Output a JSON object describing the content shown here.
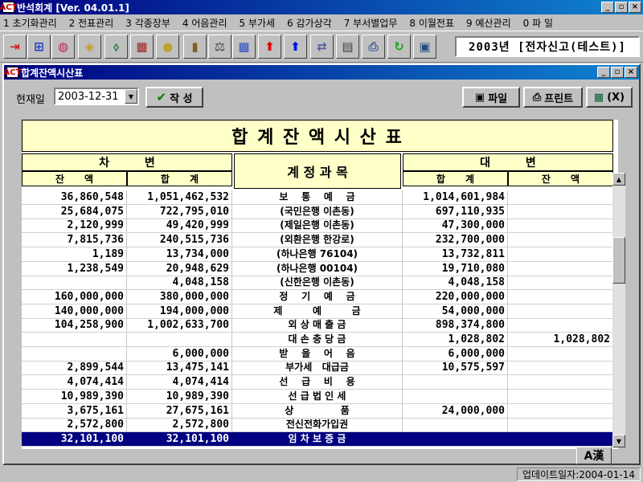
{
  "app": {
    "title": "반석회계 [Ver. 04.01.1]"
  },
  "window_buttons": {
    "minimize": "_",
    "restore": "▫",
    "close": "×"
  },
  "menu": [
    "1 초기화관리",
    "2 전표관리",
    "3 각종장부",
    "4 어음관리",
    "5 부가세",
    "6 감가상각",
    "7 부서별업무",
    "8 이월전표",
    "9 예산관리",
    "0 파 일"
  ],
  "toolbar": {
    "icons": [
      "exit-icon",
      "tree-icon",
      "globe-icon",
      "coupon-icon",
      "tag-icon",
      "abacus-icon",
      "coin-icon",
      "book-icon",
      "scale-icon",
      "grid-icon",
      "arrow-up-red-icon",
      "arrow-up-blue-icon",
      "convert-icon",
      "calculator-icon",
      "printer-icon",
      "refresh-icon",
      "report-icon"
    ],
    "colors": [
      "#d02020",
      "#2040c0",
      "#c02060",
      "#c0a020",
      "#208040",
      "#a02020",
      "#c0a030",
      "#806020",
      "#404040",
      "#3050c0",
      "#e00000",
      "#0010e0",
      "#5060a0",
      "#404040",
      "#4060a0",
      "#20a020",
      "#205080"
    ],
    "glyphs": [
      "⇥",
      "⊞",
      "◍",
      "◈",
      "⬨",
      "▦",
      "●",
      "▮",
      "⚖",
      "▩",
      "⬆",
      "⬆",
      "⇄",
      "▤",
      "⎙",
      "↻",
      "▣"
    ]
  },
  "year_display": "2003년 [전자신고(테스트)]",
  "child_window": {
    "title": "합계잔액시산표"
  },
  "controls": {
    "date_label": "현재일",
    "date_value": "2003-12-31",
    "write_button": "작 성",
    "write_icon": "✔",
    "file_button": "파일",
    "file_icon": "▣",
    "print_button": "프린트",
    "print_icon": "⎙",
    "exit_button": "(X)",
    "exit_icon": "▦"
  },
  "report": {
    "title": "합 계 잔 액 시 산 표",
    "debit_header": "차         변",
    "credit_header": "대         변",
    "account_header": "계 정 과 목",
    "balance_header": "잔      액",
    "total_header": "합      계"
  },
  "rows": [
    {
      "dr_bal": "36,860,548",
      "dr_sum": "1,051,462,532",
      "account": "보    통    예    금",
      "cr_sum": "1,014,601,984",
      "cr_bal": ""
    },
    {
      "dr_bal": "25,684,075",
      "dr_sum": "722,795,010",
      "account": "(국민은행 이촌동)",
      "cr_sum": "697,110,935",
      "cr_bal": ""
    },
    {
      "dr_bal": "2,120,999",
      "dr_sum": "49,420,999",
      "account": "(제일은행 이촌동)",
      "cr_sum": "47,300,000",
      "cr_bal": ""
    },
    {
      "dr_bal": "7,815,736",
      "dr_sum": "240,515,736",
      "account": "(외환은행 한강로)",
      "cr_sum": "232,700,000",
      "cr_bal": ""
    },
    {
      "dr_bal": "1,189",
      "dr_sum": "13,734,000",
      "account": "(하나은행 76104)",
      "cr_sum": "13,732,811",
      "cr_bal": ""
    },
    {
      "dr_bal": "1,238,549",
      "dr_sum": "20,948,629",
      "account": "(하나은행 00104)",
      "cr_sum": "19,710,080",
      "cr_bal": ""
    },
    {
      "dr_bal": "",
      "dr_sum": "4,048,158",
      "account": "(신한은행 이촌동)",
      "cr_sum": "4,048,158",
      "cr_bal": ""
    },
    {
      "dr_bal": "160,000,000",
      "dr_sum": "380,000,000",
      "account": "정    기    예    금",
      "cr_sum": "220,000,000",
      "cr_bal": ""
    },
    {
      "dr_bal": "140,000,000",
      "dr_sum": "194,000,000",
      "account": "제         예         금",
      "cr_sum": "54,000,000",
      "cr_bal": ""
    },
    {
      "dr_bal": "104,258,900",
      "dr_sum": "1,002,633,700",
      "account": "외 상 매 출 금",
      "cr_sum": "898,374,800",
      "cr_bal": ""
    },
    {
      "dr_bal": "",
      "dr_sum": "",
      "account": "대 손 충 당 금",
      "cr_sum": "1,028,802",
      "cr_bal": "1,028,802"
    },
    {
      "dr_bal": "",
      "dr_sum": "6,000,000",
      "account": "받    을    어    음",
      "cr_sum": "6,000,000",
      "cr_bal": ""
    },
    {
      "dr_bal": "2,899,544",
      "dr_sum": "13,475,141",
      "account": "부가세   대급금",
      "cr_sum": "10,575,597",
      "cr_bal": ""
    },
    {
      "dr_bal": "4,074,414",
      "dr_sum": "4,074,414",
      "account": "선    급    비    용",
      "cr_sum": "",
      "cr_bal": ""
    },
    {
      "dr_bal": "10,989,390",
      "dr_sum": "10,989,390",
      "account": "선 급 법 인 세",
      "cr_sum": "",
      "cr_bal": ""
    },
    {
      "dr_bal": "3,675,161",
      "dr_sum": "27,675,161",
      "account": "상              품",
      "cr_sum": "24,000,000",
      "cr_bal": ""
    },
    {
      "dr_bal": "2,572,800",
      "dr_sum": "2,572,800",
      "account": "전신전화가입권",
      "cr_sum": "",
      "cr_bal": ""
    },
    {
      "dr_bal": "32,101,100",
      "dr_sum": "32,101,100",
      "account": "임 차 보 증 금",
      "cr_sum": "",
      "cr_bal": "",
      "selected": true
    }
  ],
  "scroll": {
    "up": "▲",
    "down": "▼"
  },
  "hanja_toggle": "A漢",
  "status": {
    "update": "업데이트일자:2004-01-14"
  }
}
